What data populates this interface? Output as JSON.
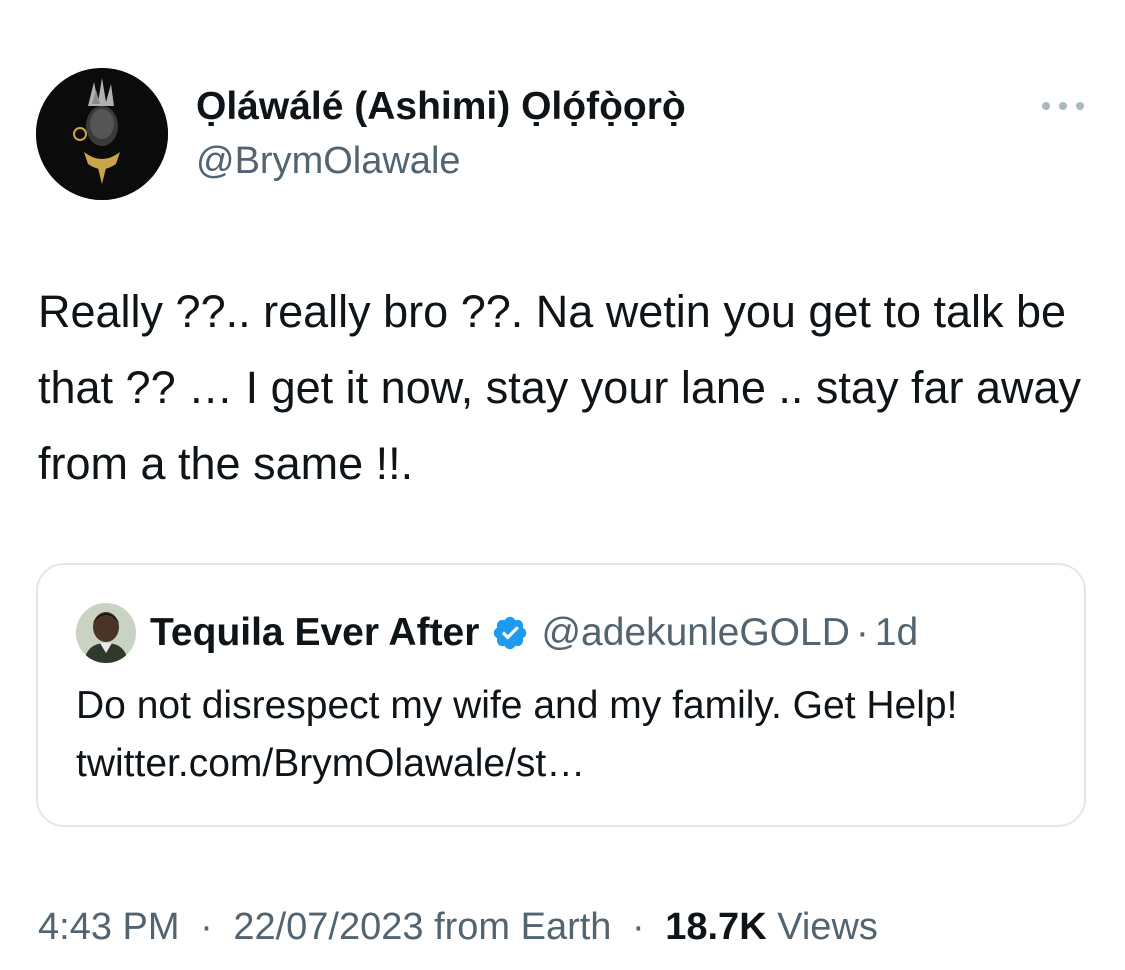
{
  "tweet": {
    "author": {
      "display_name": "Ọláwálé (Ashimi) Ọlọ́fọ̀ọrọ̀",
      "handle": "@BrymOlawale",
      "avatar_icon": "profile-avatar"
    },
    "more_icon": "more-horizontal-icon",
    "body": "Really ??.. really bro ??. Na wetin you get to talk be that ?? … I get it now, stay your lane .. stay far away from a the same !!.",
    "quoted": {
      "display_name": "Tequila Ever After",
      "verified": true,
      "handle": "@adekunleGOLD",
      "separator": "·",
      "time": "1d",
      "text": "Do not disrespect my wife and my family. Get Help! twitter.com/BrymOlawale/st…"
    },
    "meta": {
      "time": "4:43 PM",
      "date": "22/07/2023",
      "source": "from Earth",
      "separator": "·",
      "views_count": "18.7K",
      "views_label": "Views"
    }
  },
  "colors": {
    "text_primary": "#0f1419",
    "text_secondary": "#536471",
    "verified_blue": "#1d9bf0",
    "card_border": "#e1e8ed"
  }
}
